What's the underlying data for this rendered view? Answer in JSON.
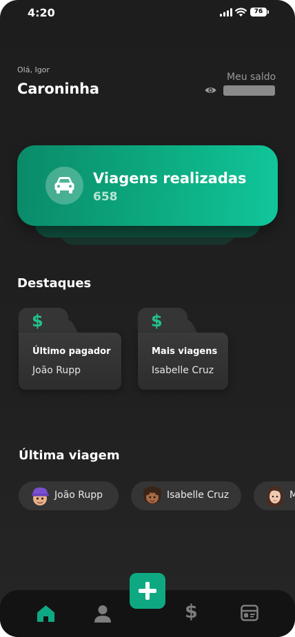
{
  "status_bar": {
    "time": "4:20",
    "battery": "76"
  },
  "header": {
    "greeting": "Olá, Igor",
    "app_title": "Caroninha",
    "balance_label": "Meu saldo"
  },
  "trips_card": {
    "title": "Viagens realizadas",
    "count": "658"
  },
  "highlights": {
    "title": "Destaques",
    "items": [
      {
        "icon": "dollar-icon",
        "label": "Último pagador",
        "name": "João Rupp"
      },
      {
        "icon": "dollar-icon",
        "label": "Mais viagens",
        "name": "Isabelle Cruz"
      }
    ]
  },
  "last_trip": {
    "title": "Última viagem",
    "passengers": [
      {
        "name": "João Rupp",
        "avatar": "memoji-purple-cap"
      },
      {
        "name": "Isabelle Cruz",
        "avatar": "memoji-curly-hair"
      },
      {
        "name": "M",
        "avatar": "memoji-long-hair"
      }
    ]
  },
  "nav": {
    "items": [
      {
        "icon": "home-icon",
        "active": true
      },
      {
        "icon": "user-icon",
        "active": false
      },
      {
        "icon": "add-icon",
        "active": false
      },
      {
        "icon": "dollar-icon",
        "active": false
      },
      {
        "icon": "wallet-icon",
        "active": false
      }
    ]
  },
  "colors": {
    "accent": "#0ea982",
    "accent_light": "#11c69b",
    "dollar": "#22c289",
    "background": "#1f1f1f",
    "nav_background": "#131313"
  }
}
